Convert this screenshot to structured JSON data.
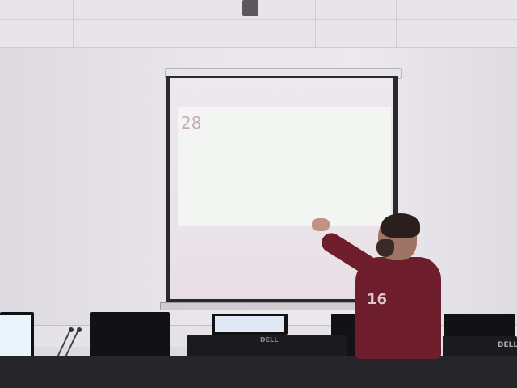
{
  "scene": {
    "description_label": ""
  },
  "projection": {
    "number": "28"
  },
  "person": {
    "shirt_text": "16"
  },
  "monitor_brand": "DELL",
  "colors": {
    "wall": "#e9e7ec",
    "projection": "#f3f5f2",
    "shirt": "#6e1d2c",
    "desk": "#26252a"
  }
}
